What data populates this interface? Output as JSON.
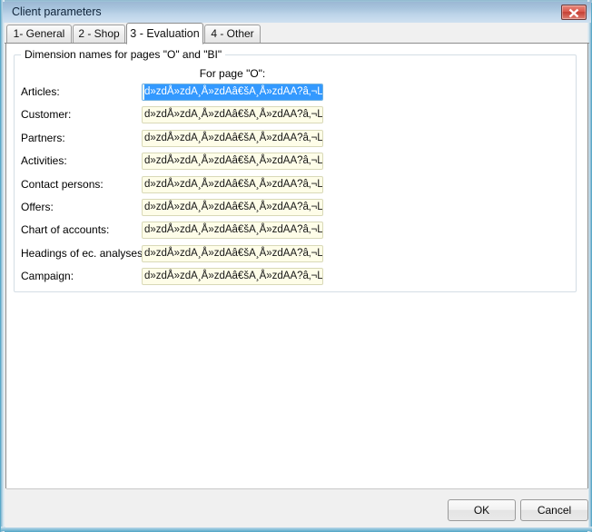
{
  "window": {
    "title": "Client parameters",
    "close_icon": "close-x-icon",
    "accent_border": "#5aa9c8",
    "titlebar_color": "#aac6de"
  },
  "tabs": [
    {
      "label": "1- General",
      "active": false
    },
    {
      "label": "2 - Shop",
      "active": false
    },
    {
      "label": "3 - Evaluation",
      "active": true
    },
    {
      "label": "4 - Other",
      "active": false
    }
  ],
  "groupbox": {
    "caption": "Dimension names for pages \"O\" and \"BI\"",
    "column_header": "For page \"O\":"
  },
  "fields": [
    {
      "label": "Articles:",
      "value": "d»zdÅ»zdA¸Å»zdAâ€šA¸Å»zdAA?â‚¬L?A",
      "focused": true
    },
    {
      "label": "Customer:",
      "value": "d»zdÅ»zdA¸Å»zdAâ€šA¸Å»zdAA?â‚¬L?Aż",
      "focused": false
    },
    {
      "label": "Partners:",
      "value": "d»zdÅ»zdA¸Å»zdAâ€šA¸Å»zdAA?â‚¬L?Aż",
      "focused": false
    },
    {
      "label": "Activities:",
      "value": "d»zdÅ»zdA¸Å»zdAâ€šA¸Å»zdAA?â‚¬L?Aż",
      "focused": false
    },
    {
      "label": "Contact persons:",
      "value": "d»zdÅ»zdA¸Å»zdAâ€šA¸Å»zdAA?â‚¬L?Aż",
      "focused": false
    },
    {
      "label": "Offers:",
      "value": "d»zdÅ»zdA¸Å»zdAâ€šA¸Å»zdAA?â‚¬L?Aż",
      "focused": false
    },
    {
      "label": "Chart of accounts:",
      "value": "d»zdÅ»zdA¸Å»zdAâ€šA¸Å»zdAA?â‚¬L?Aż",
      "focused": false
    },
    {
      "label": "Headings of ec. analyses:",
      "value": "d»zdÅ»zdA¸Å»zdAâ€šA¸Å»zdAA?â‚¬L?Aż",
      "focused": false
    },
    {
      "label": "Campaign:",
      "value": "d»zdÅ»zdA¸Å»zdAâ€šA¸Å»zdAA?â‚¬L?Aż",
      "focused": false
    }
  ],
  "footer": {
    "ok_label": "OK",
    "cancel_label": "Cancel"
  }
}
